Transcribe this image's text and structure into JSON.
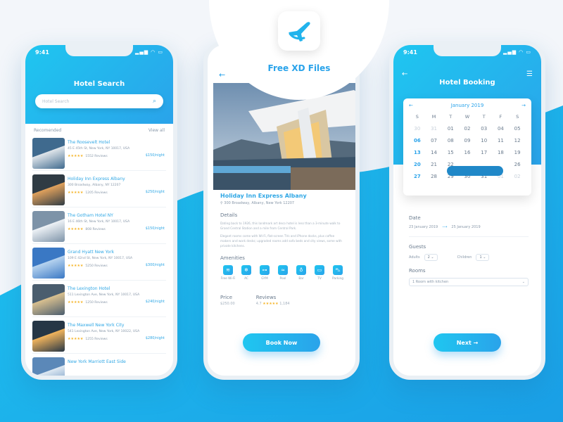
{
  "brand": {
    "title": "Free XD Files",
    "accent": "#2aa3ea",
    "gradient_start": "#1fc6f0"
  },
  "status_bar": {
    "time": "9:41",
    "icons": "▂▄▆ ◠ ▭"
  },
  "hotel_search": {
    "title": "Hotel Search",
    "search_placeholder": "Hotel Search",
    "recommended_label": "Recomended",
    "view_all_label": "View all",
    "hotels": [
      {
        "name": "The Roosevelt Hotel",
        "address": "45 E 45th St, New York, NY 10017, USA",
        "stars": "★★★★★",
        "reviews": "1552 Reviews",
        "price": "$150/night"
      },
      {
        "name": "Holiday Inn Express Albany",
        "address": "300 Broadway, Albany, NY 12207",
        "stars": "★★★★★",
        "reviews": "1205 Reviews",
        "price": "$250/night"
      },
      {
        "name": "The Gotham Hotel NY",
        "address": "16 E 46th St, New York, NY 10017, USA",
        "stars": "★★★★★",
        "reviews": "808 Reviews",
        "price": "$150/night"
      },
      {
        "name": "Grand Hyatt New York",
        "address": "109 E 42nd St, New York, NY 10017, USA",
        "stars": "★★★★★",
        "reviews": "5250 Reviews",
        "price": "$300/night"
      },
      {
        "name": "The Lexington Hotel",
        "address": "511 Lexington Ave, New York, NY 10017, USA",
        "stars": "★★★★★",
        "reviews": "1250 Reviews",
        "price": "$240/night"
      },
      {
        "name": "The Maxwell New York City",
        "address": "541 Lexington Ave, New York, NY 10022, USA",
        "stars": "★★★★★",
        "reviews": "1255 Reviews",
        "price": "$280/night"
      },
      {
        "name": "New York Marriott East Side",
        "address": "",
        "stars": "",
        "reviews": "",
        "price": ""
      }
    ]
  },
  "hotel_detail": {
    "name": "Holiday Inn Express Albany",
    "address": "300 Broadway, Albany, New York 12207",
    "details_heading": "Details",
    "paragraph_1": "Dating back to 1926, this landmark art deco hotel is less than a 3-minute walk to Grand Central Station and a mile from Central Park.",
    "paragraph_2": "Elegant rooms come with Wi-Fi, flat-screen TVs and iPhone docks, plus coffee makers and work desks; upgraded rooms add sofa beds and city views, some with private kitchens.",
    "amenities_heading": "Amenities",
    "amenities": [
      {
        "label": "Free Wi-Fi",
        "icon": "wifi-icon",
        "glyph": "≋"
      },
      {
        "label": "AC",
        "icon": "ac-icon",
        "glyph": "❄"
      },
      {
        "label": "GYM",
        "icon": "gym-icon",
        "glyph": "⊶"
      },
      {
        "label": "Pool",
        "icon": "pool-icon",
        "glyph": "≈"
      },
      {
        "label": "Bar",
        "icon": "bar-icon",
        "glyph": "♁"
      },
      {
        "label": "TV",
        "icon": "tv-icon",
        "glyph": "▭"
      },
      {
        "label": "Parking",
        "icon": "car-icon",
        "glyph": "⛍"
      }
    ],
    "price_label": "Price",
    "price_value": "$250.00",
    "reviews_label": "Reviews",
    "rating": "4.7",
    "rating_stars": "★★★★★",
    "reviews_count": "1,184",
    "book_button": "Book Now"
  },
  "hotel_booking": {
    "title": "Hotel Booking",
    "month": "January 2019",
    "weekdays": [
      "S",
      "M",
      "T",
      "W",
      "T",
      "F",
      "S"
    ],
    "weeks": [
      [
        "30",
        "31",
        "01",
        "02",
        "03",
        "04",
        "05"
      ],
      [
        "06",
        "07",
        "08",
        "09",
        "10",
        "11",
        "12"
      ],
      [
        "13",
        "14",
        "15",
        "16",
        "17",
        "18",
        "19"
      ],
      [
        "20",
        "21",
        "22",
        "23",
        "24",
        "25",
        "26"
      ],
      [
        "27",
        "28",
        "29",
        "30",
        "31",
        "01",
        "02"
      ]
    ],
    "selected_range": [
      "23",
      "24",
      "25"
    ],
    "date_label": "Date",
    "check_in": "23 January 2019",
    "check_out": "25 January 2019",
    "guests_label": "Guests",
    "adults_label": "Adults",
    "adults_value": "2",
    "children_label": "Children",
    "children_value": "1",
    "rooms_label": "Rooms",
    "rooms_value": "1 Room with kitchen",
    "next_button": "Next →"
  }
}
